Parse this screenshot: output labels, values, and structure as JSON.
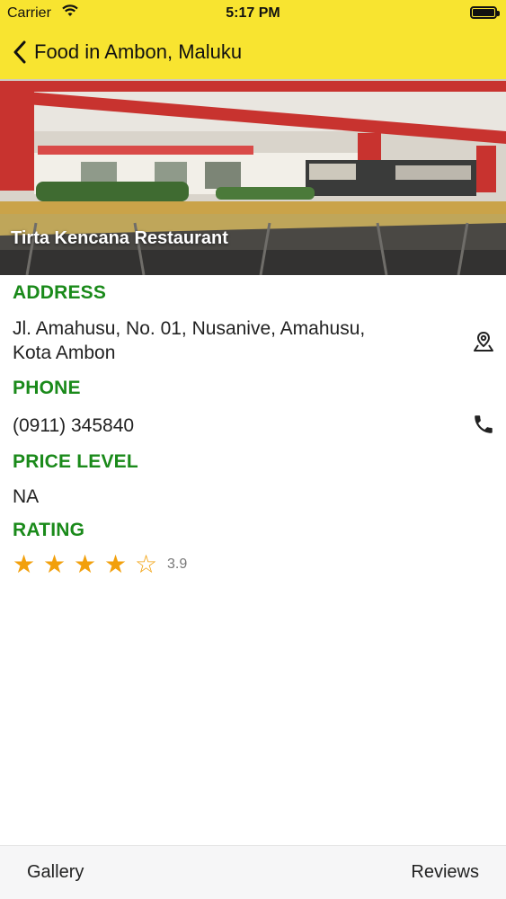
{
  "status_bar": {
    "carrier": "Carrier",
    "time": "5:17 PM"
  },
  "nav": {
    "title": "Food in Ambon, Maluku"
  },
  "hero": {
    "name": "Tirta Kencana Restaurant"
  },
  "address": {
    "label": "ADDRESS",
    "line1": "Jl. Amahusu, No. 01, Nusanive, Amahusu,",
    "line2": "Kota Ambon"
  },
  "phone": {
    "label": "PHONE",
    "value": "(0911) 345840"
  },
  "price": {
    "label": "PRICE LEVEL",
    "value": "NA"
  },
  "rating": {
    "label": "RATING",
    "value": "3.9",
    "filled_stars": 4,
    "total_stars": 5
  },
  "tabs": {
    "gallery": "Gallery",
    "reviews": "Reviews"
  },
  "colors": {
    "nav_bg": "#f8e430",
    "label_green": "#1a8a1a",
    "star": "#f2a00c"
  }
}
